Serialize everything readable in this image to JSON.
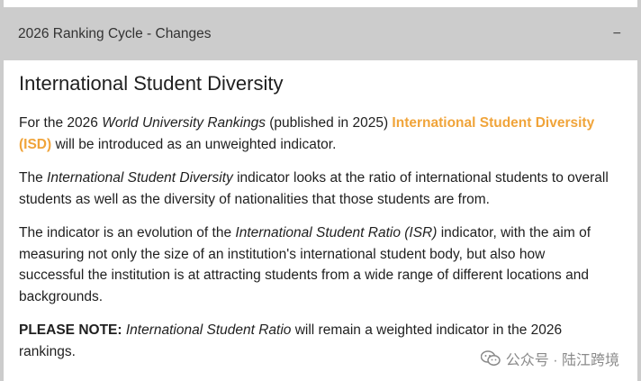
{
  "accordion": {
    "title": "2026 Ranking Cycle - Changes",
    "toggle_icon": "−"
  },
  "section": {
    "title": "International Student Diversity",
    "p1": {
      "a": "For the 2026 ",
      "b_italic": "World University Rankings",
      "c": " (published in 2025) ",
      "d_highlight": "International Student Diversity (ISD)",
      "e": " will be introduced as an unweighted indicator."
    },
    "p2": {
      "a": "The ",
      "b_italic": "International Student Diversity",
      "c": " indicator looks at the ratio of international students to overall students as well as the diversity of nationalities that those students are from."
    },
    "p3": {
      "a": "The indicator is an evolution of the ",
      "b_italic": "International Student Ratio (ISR)",
      "c": " indicator, with the aim of measuring not only the size of an institution's international student body, but also how successful the institution is at attracting students from a wide range of different locations and backgrounds."
    },
    "note": {
      "label": "PLEASE NOTE:",
      "b_italic": "International Student Ratio",
      "c": " will remain a weighted indicator in the 2026 rankings."
    }
  },
  "colors": {
    "header_bg": "#cccccc",
    "highlight": "#f0a43a"
  },
  "watermark": {
    "text": "公众号 · 陆江跨境",
    "icon": "wechat-icon"
  }
}
